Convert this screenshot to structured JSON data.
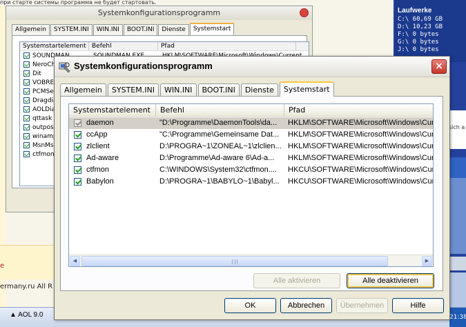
{
  "background": {
    "top_text": "при старте системы программа не будет стартовать.",
    "orange_text": "e",
    "site_text": "ermany.ru All R",
    "taskbar_item": "AOL 9.0",
    "clock": "21:38",
    "drives_title": "Laufwerke",
    "drives": [
      "C:\\ 60,69 GB",
      "D:\\ 10,23 GB",
      "F:\\ 0 bytes",
      "G:\\ 0 bytes",
      "J:\\ 0 bytes"
    ],
    "side_text": "sich a"
  },
  "back_window": {
    "title": "Systemkonfigurationsprogramm",
    "tabs": [
      "Allgemein",
      "SYSTEM.INI",
      "WIN.INI",
      "BOOT.INI",
      "Dienste",
      "Systemstart"
    ],
    "columns": [
      "Systemstartelement",
      "Befehl",
      "Pfad"
    ],
    "items": [
      "SOUNDMAN",
      "NeroCheck",
      "Dit",
      "VOBREGC",
      "PCMService",
      "Dragdiag",
      "AOLDial",
      "qttask",
      "outpost",
      "winampa",
      "MsnMsgr",
      "ctfmon"
    ],
    "first_command": "SOUNDMAN.EXE",
    "first_path": "HKLM\\SOFTWARE\\Microsoft\\Windows\\Current"
  },
  "window": {
    "title": "Systemkonfigurationsprogramm",
    "close_symbol": "×",
    "tabs": [
      {
        "label": "Allgemein",
        "active": false
      },
      {
        "label": "SYSTEM.INI",
        "active": false
      },
      {
        "label": "WIN.INI",
        "active": false
      },
      {
        "label": "BOOT.INI",
        "active": false
      },
      {
        "label": "Dienste",
        "active": false
      },
      {
        "label": "Systemstart",
        "active": true
      }
    ],
    "columns": {
      "element": "Systemstartelement",
      "command": "Befehl",
      "path": "Pfad"
    },
    "rows": [
      {
        "name": "daemon",
        "command": "\"D:\\Programme\\DaemonTools\\da...",
        "path": "HKLM\\SOFTWARE\\Microsoft\\Windows\\Curre",
        "checked": true,
        "selected": true
      },
      {
        "name": "ccApp",
        "command": "\"C:\\Programme\\Gemeinsame Dat...",
        "path": "HKLM\\SOFTWARE\\Microsoft\\Windows\\Curre",
        "checked": true,
        "selected": false
      },
      {
        "name": "zlclient",
        "command": "D:\\PROGRA~1\\ZONEAL~1\\zlclien...",
        "path": "HKLM\\SOFTWARE\\Microsoft\\Windows\\Curre",
        "checked": true,
        "selected": false
      },
      {
        "name": "Ad-aware",
        "command": "D:\\Programme\\Ad-aware 6\\Ad-a...",
        "path": "HKLM\\SOFTWARE\\Microsoft\\Windows\\Curre",
        "checked": true,
        "selected": false
      },
      {
        "name": "ctfmon",
        "command": "C:\\WINDOWS\\System32\\ctfmon....",
        "path": "HKCU\\SOFTWARE\\Microsoft\\Windows\\Curre",
        "checked": true,
        "selected": false
      },
      {
        "name": "Babylon",
        "command": "D:\\PROGRA~1\\BABYLO~1\\Babyl...",
        "path": "HKCU\\SOFTWARE\\Microsoft\\Windows\\Curre",
        "checked": true,
        "selected": false
      }
    ],
    "buttons": {
      "enable_all": "Alle aktivieren",
      "disable_all": "Alle deaktivieren",
      "ok": "OK",
      "cancel": "Abbrechen",
      "apply": "Übernehmen",
      "help": "Hilfe"
    }
  }
}
